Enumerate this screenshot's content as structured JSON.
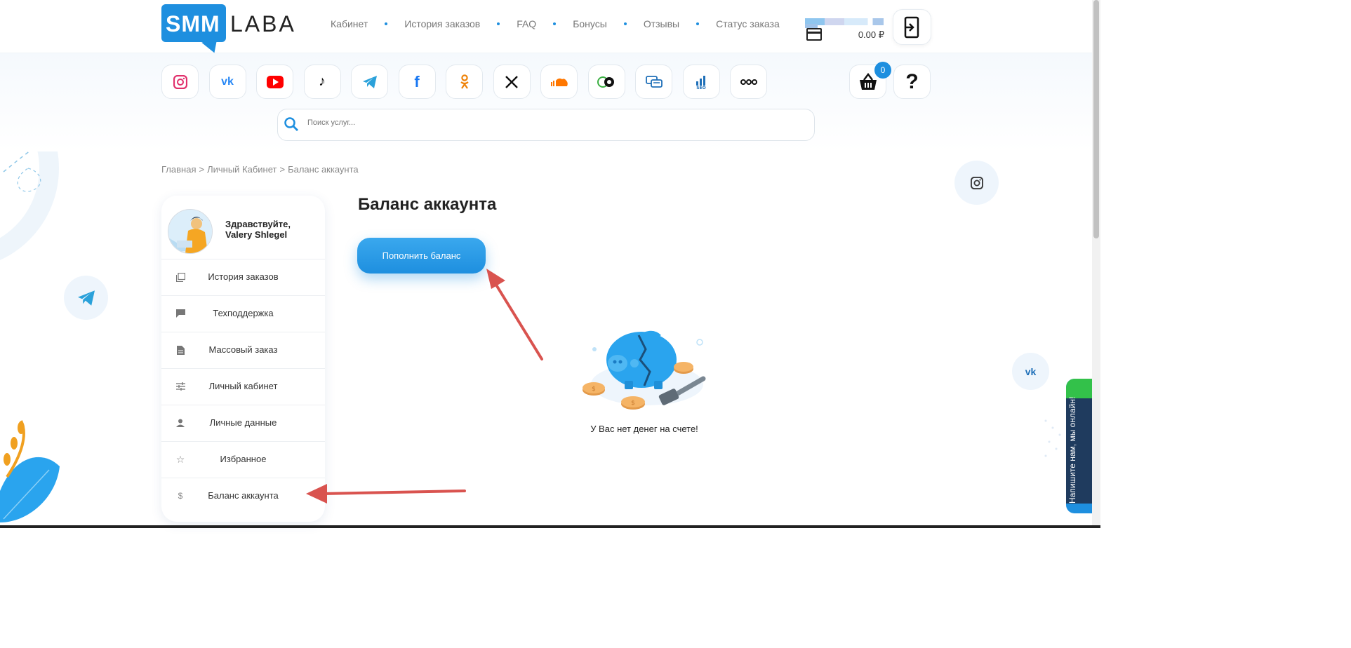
{
  "brand": {
    "logo_left": "SMM",
    "logo_right": "LABA"
  },
  "nav": [
    "Кабинет",
    "История заказов",
    "FAQ",
    "Бонусы",
    "Отзывы",
    "Статус заказа"
  ],
  "header": {
    "balance": "0.00 ₽"
  },
  "social_icons": [
    "instagram-icon",
    "vk-icon",
    "youtube-icon",
    "tiktok-icon",
    "telegram-icon",
    "facebook-icon",
    "odnoklassniki-icon",
    "x-icon",
    "soundcloud-icon",
    "twitch-icon",
    "chat-icon",
    "seo-icon",
    "more-icon"
  ],
  "cart": {
    "count": "0"
  },
  "search": {
    "placeholder": "Поиск услуг..."
  },
  "breadcrumb": [
    "Главная",
    ">",
    "Личный Кабинет",
    ">",
    "Баланс аккаунта"
  ],
  "sidebar": {
    "greeting": "Здравствуйте, Valery Shlegel",
    "items": [
      {
        "label": "История заказов",
        "icon": "copy-icon"
      },
      {
        "label": "Техподдержка",
        "icon": "message-icon"
      },
      {
        "label": "Массовый заказ",
        "icon": "document-icon"
      },
      {
        "label": "Личный кабинет",
        "icon": "sliders-icon"
      },
      {
        "label": "Личные данные",
        "icon": "user-icon"
      },
      {
        "label": "Избранное",
        "icon": "star-icon"
      },
      {
        "label": "Баланс аккаунта",
        "icon": "dollar-icon"
      }
    ]
  },
  "main": {
    "title": "Баланс аккаунта",
    "topup_label": "Пополнить баланс",
    "empty_message": "У Вас нет денег на счете!"
  },
  "chat": {
    "label": "Напишите нам, мы онлайн!"
  },
  "colors": {
    "accent": "#1e8fdf",
    "arrow": "#d9534f"
  }
}
